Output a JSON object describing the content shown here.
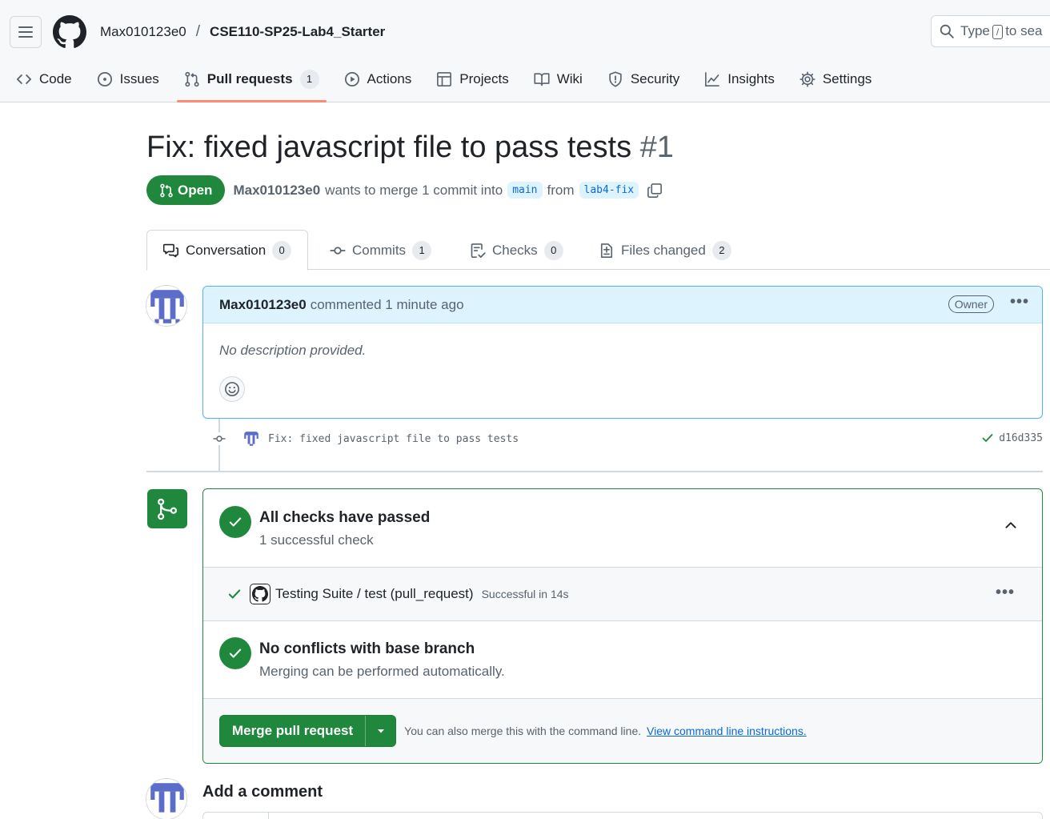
{
  "header": {
    "owner": "Max010123e0",
    "separator": "/",
    "repo": "CSE110-SP25-Lab4_Starter",
    "search": {
      "prefix": "Type",
      "key": "/",
      "suffix": "to sea"
    }
  },
  "nav": {
    "items": [
      {
        "label": "Code",
        "icon": "code-icon"
      },
      {
        "label": "Issues",
        "icon": "issue-icon"
      },
      {
        "label": "Pull requests",
        "icon": "pull-request-icon",
        "count": "1",
        "active": true
      },
      {
        "label": "Actions",
        "icon": "play-icon"
      },
      {
        "label": "Projects",
        "icon": "table-icon"
      },
      {
        "label": "Wiki",
        "icon": "book-icon"
      },
      {
        "label": "Security",
        "icon": "shield-icon"
      },
      {
        "label": "Insights",
        "icon": "graph-icon"
      },
      {
        "label": "Settings",
        "icon": "gear-icon"
      }
    ]
  },
  "pr": {
    "title": "Fix: fixed javascript file to pass tests",
    "number": "#1",
    "state": "Open",
    "author": "Max010123e0",
    "merge_text": "wants to merge 1 commit into",
    "base_branch": "main",
    "from_text": "from",
    "head_branch": "lab4-fix"
  },
  "tabs": [
    {
      "label": "Conversation",
      "count": "0",
      "icon": "comment-discussion-icon"
    },
    {
      "label": "Commits",
      "count": "1",
      "icon": "commit-icon"
    },
    {
      "label": "Checks",
      "count": "0",
      "icon": "checklist-icon"
    },
    {
      "label": "Files changed",
      "count": "2",
      "icon": "file-diff-icon"
    }
  ],
  "comment": {
    "author": "Max010123e0",
    "meta": "commented 1 minute ago",
    "badge": "Owner",
    "body": "No description provided."
  },
  "commit": {
    "message": "Fix: fixed javascript file to pass tests",
    "sha": "d16d335"
  },
  "merge": {
    "checks_title": "All checks have passed",
    "checks_sub": "1 successful check",
    "check_name": "Testing Suite / test (pull_request)",
    "check_duration": "Successful in 14s",
    "conflicts_title": "No conflicts with base branch",
    "conflicts_sub": "Merging can be performed automatically.",
    "button_label": "Merge pull request",
    "note": "You can also merge this with the command line.",
    "link": "View command line instructions."
  },
  "add_comment": {
    "title": "Add a comment"
  },
  "colors": {
    "accent": "#1f883d",
    "link": "#0969da",
    "underline": "#fd8c73"
  }
}
